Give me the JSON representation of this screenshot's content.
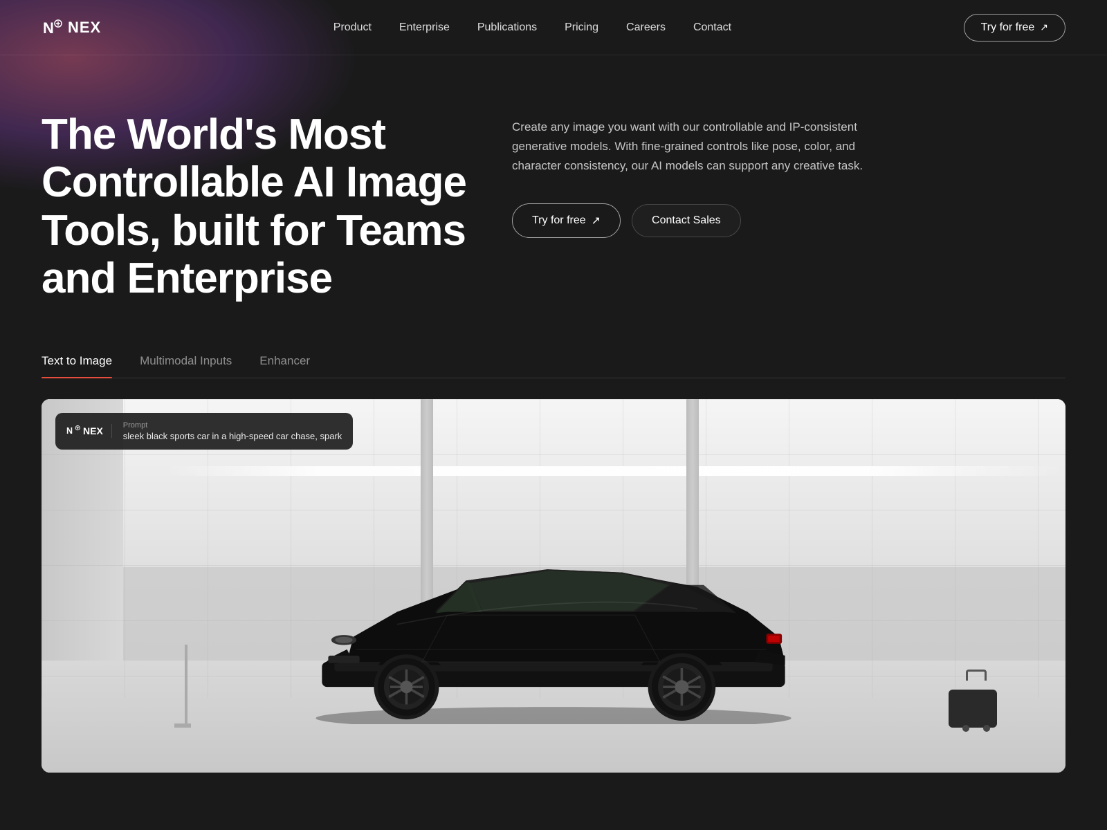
{
  "brand": {
    "name": "NEX",
    "logo_text": "NEX"
  },
  "nav": {
    "links": [
      {
        "label": "Product",
        "href": "#"
      },
      {
        "label": "Enterprise",
        "href": "#"
      },
      {
        "label": "Publications",
        "href": "#"
      },
      {
        "label": "Pricing",
        "href": "#"
      },
      {
        "label": "Careers",
        "href": "#"
      },
      {
        "label": "Contact",
        "href": "#"
      }
    ],
    "cta_label": "Try for free",
    "cta_arrow": "↗"
  },
  "hero": {
    "title": "The World's Most Controllable AI Image Tools, built for Teams and Enterprise",
    "description": "Create any image you want with our controllable and IP-consistent generative models. With fine-grained controls like pose, color, and character consistency, our AI models can support any creative task.",
    "try_free_label": "Try for free",
    "try_free_arrow": "↗",
    "contact_sales_label": "Contact Sales"
  },
  "tabs": [
    {
      "label": "Text to Image",
      "active": true
    },
    {
      "label": "Multimodal Inputs",
      "active": false
    },
    {
      "label": "Enhancer",
      "active": false
    }
  ],
  "demo": {
    "prompt_label": "Prompt",
    "prompt_text": "sleek black sports car in a high-speed car chase, spark",
    "logo_text": "NEX"
  }
}
